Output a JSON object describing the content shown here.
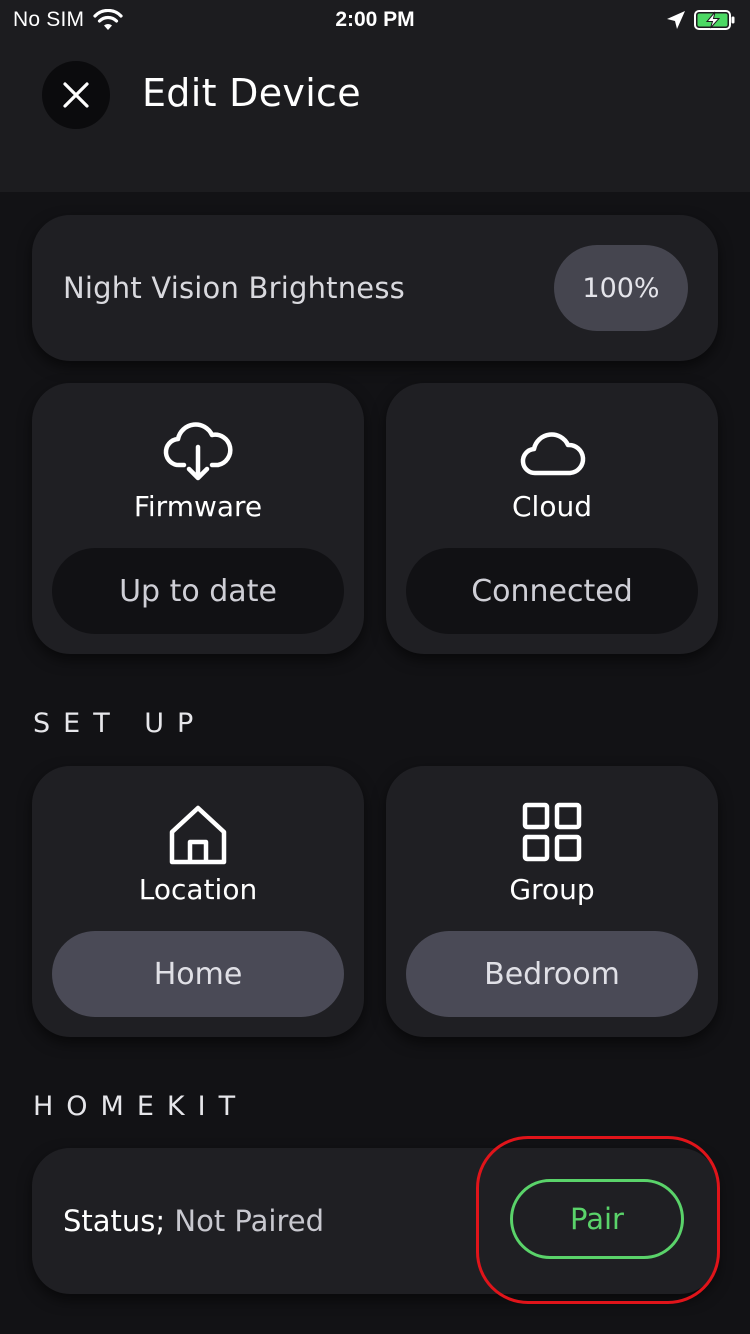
{
  "status_bar": {
    "carrier": "No SIM",
    "time": "2:00 PM",
    "icons": [
      "wifi-icon",
      "location-arrow-icon",
      "battery-charging-icon"
    ]
  },
  "header": {
    "title": "Edit Device",
    "close_icon": "close-icon"
  },
  "night_vision": {
    "label": "Night Vision Brightness",
    "value": "100%"
  },
  "status_tiles": [
    {
      "icon": "cloud-download-icon",
      "label": "Firmware",
      "value": "Up to date"
    },
    {
      "icon": "cloud-icon",
      "label": "Cloud",
      "value": "Connected"
    }
  ],
  "setup": {
    "heading": "SET UP",
    "tiles": [
      {
        "icon": "home-icon",
        "label": "Location",
        "value": "Home"
      },
      {
        "icon": "grid-icon",
        "label": "Group",
        "value": "Bedroom"
      }
    ]
  },
  "homekit": {
    "heading": "HOMEKIT",
    "status_prefix": "Status;",
    "status_value": "Not Paired",
    "pair_label": "Pair"
  },
  "colors": {
    "background": "#121215",
    "card": "#1f1f23",
    "pill_grey": "#4a4a56",
    "accent_green": "#5ad36a",
    "highlight_red": "#e0141a"
  }
}
